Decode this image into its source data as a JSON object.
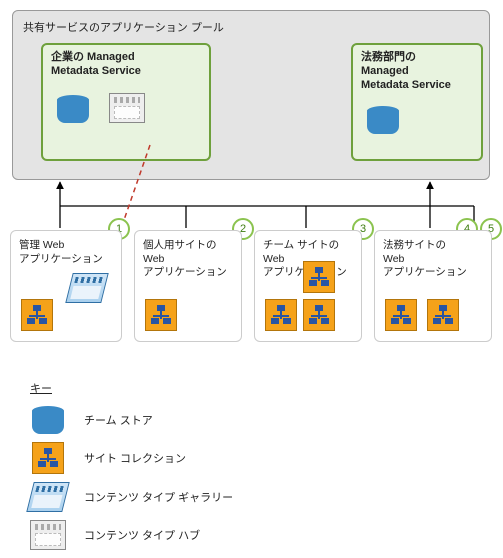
{
  "pool": {
    "title": "共有サービスのアプリケーション プール",
    "services": {
      "corp": {
        "title_line1": "企業の Managed",
        "title_line2": "Metadata Service"
      },
      "legal": {
        "title_line1": "法務部門の",
        "title_line2": "Managed",
        "title_line3": "Metadata Service"
      }
    }
  },
  "apps": {
    "app1": {
      "title_line1": "管理 Web",
      "title_line2": "アプリケーション"
    },
    "app2": {
      "title_line1": "個人用サイトの",
      "title_line2": "Web",
      "title_line3": "アプリケーション"
    },
    "app3": {
      "title_line1": "チーム サイトの",
      "title_line2": "Web",
      "title_line3": "アプリケーション"
    },
    "app4": {
      "title_line1": "法務サイトの",
      "title_line2": "Web",
      "title_line3": "アプリケーション"
    }
  },
  "markers": {
    "n1": "1",
    "n2": "2",
    "n3": "3",
    "n4": "4",
    "n5": "5"
  },
  "legend": {
    "title": "キー",
    "items": {
      "term_store": "チーム ストア",
      "site_collection": "サイト コレクション",
      "content_type_gallery": "コンテンツ タイプ ギャラリー",
      "content_type_hub": "コンテンツ タイプ ハブ"
    }
  }
}
